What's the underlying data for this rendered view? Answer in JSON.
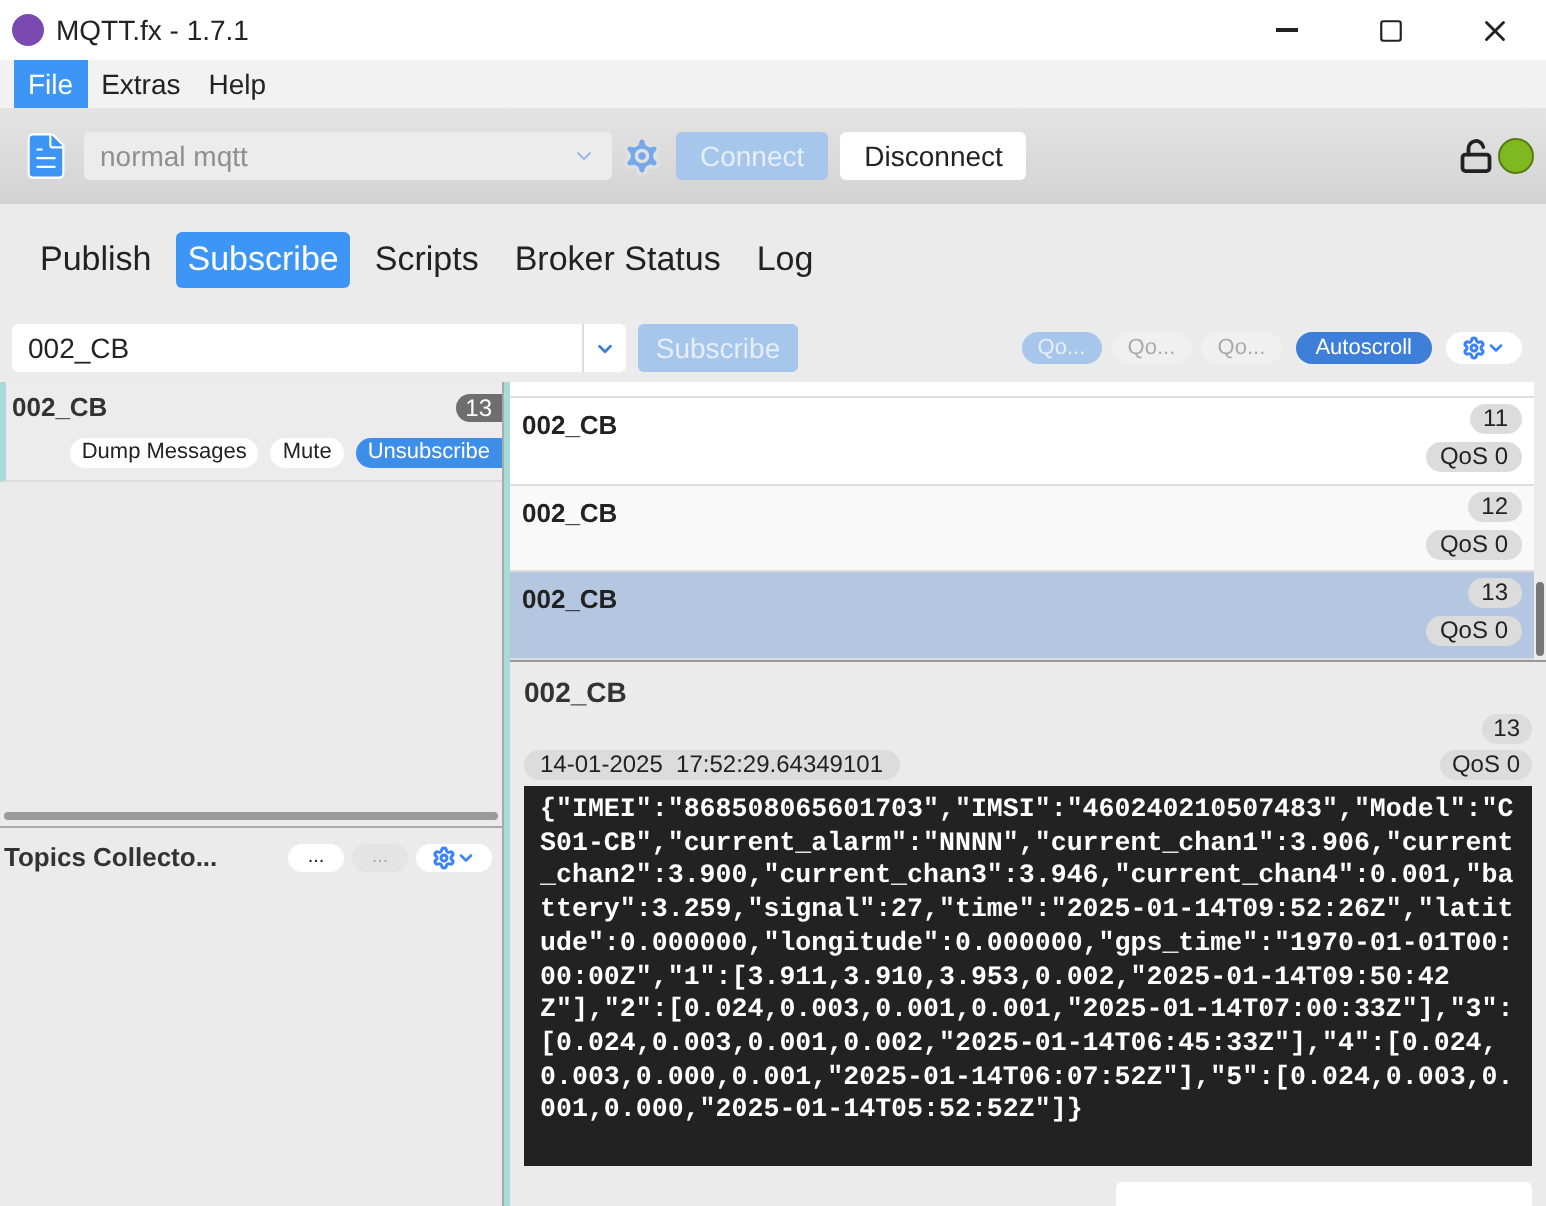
{
  "window": {
    "title": "MQTT.fx - 1.7.1"
  },
  "menu": [
    {
      "label": "File",
      "selected": true
    },
    {
      "label": "Extras",
      "selected": false
    },
    {
      "label": "Help",
      "selected": false
    }
  ],
  "toolbar": {
    "profile": "normal mqtt",
    "connect": {
      "label": "Connect",
      "disabled": true
    },
    "disconnect": {
      "label": "Disconnect",
      "disabled": false
    },
    "connected": true
  },
  "tabs": [
    {
      "label": "Publish",
      "selected": false
    },
    {
      "label": "Subscribe",
      "selected": true
    },
    {
      "label": "Scripts",
      "selected": false
    },
    {
      "label": "Broker Status",
      "selected": false
    },
    {
      "label": "Log",
      "selected": false
    }
  ],
  "subscribe_bar": {
    "topic": "002_CB",
    "button": {
      "label": "Subscribe",
      "disabled": true
    },
    "qos_buttons": [
      {
        "label": "Qo...",
        "selected": true
      },
      {
        "label": "Qo...",
        "selected": false
      },
      {
        "label": "Qo...",
        "selected": false
      }
    ],
    "autoscroll": {
      "label": "Autoscroll",
      "on": true
    }
  },
  "subscriptions": [
    {
      "topic": "002_CB",
      "count": "13",
      "buttons": [
        "Dump Messages",
        "Mute",
        "Unsubscribe"
      ]
    }
  ],
  "topics_collector": {
    "title": "Topics Collecto...",
    "buttons": [
      {
        "label": "...",
        "disabled": false
      },
      {
        "label": "...",
        "disabled": true
      }
    ]
  },
  "messages": [
    {
      "topic": "002_CB",
      "number": "11",
      "qos": "QoS 0",
      "selected": false
    },
    {
      "topic": "002_CB",
      "number": "12",
      "qos": "QoS 0",
      "selected": false
    },
    {
      "topic": "002_CB",
      "number": "13",
      "qos": "QoS 0",
      "selected": true
    }
  ],
  "detail": {
    "topic": "002_CB",
    "number": "13",
    "timestamp": "14-01-2025  17:52:29.64349101",
    "qos": "QoS 0",
    "payload": "{\"IMEI\":\"868508065601703\",\"IMSI\":\"460240210507483\",\"Model\":\"CS01-CB\",\"current_alarm\":\"NNNN\",\"current_chan1\":3.906,\"current_chan2\":3.900,\"current_chan3\":3.946,\"current_chan4\":0.001,\"battery\":3.259,\"signal\":27,\"time\":\"2025-01-14T09:52:26Z\",\"latitude\":0.000000,\"longitude\":0.000000,\"gps_time\":\"1970-01-01T00:00:00Z\",\"1\":[3.911,3.910,3.953,0.002,\"2025-01-14T09:50:42Z\"],\"2\":[0.024,0.003,0.001,0.001,\"2025-01-14T07:00:33Z\"],\"3\":[0.024,0.003,0.001,0.002,\"2025-01-14T06:45:33Z\"],\"4\":[0.024,0.003,0.000,0.001,\"2025-01-14T06:07:52Z\"],\"5\":[0.024,0.003,0.001,0.000,\"2025-01-14T05:52:52Z\"]}"
  }
}
